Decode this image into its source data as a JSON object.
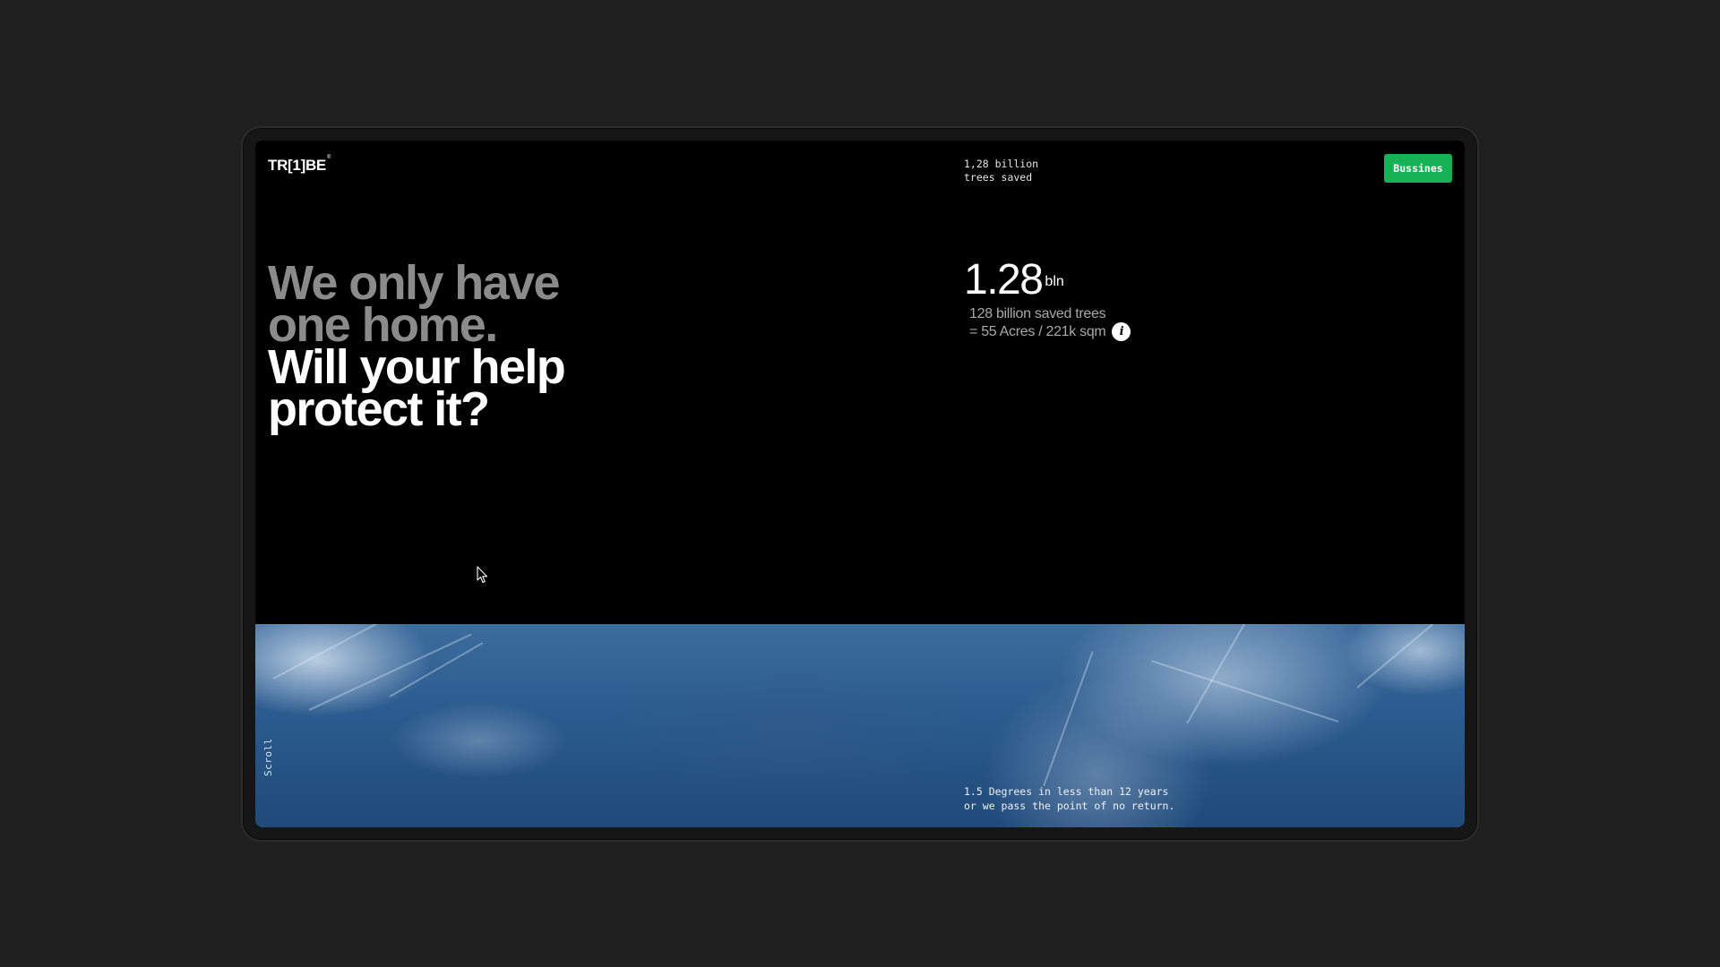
{
  "header": {
    "logo": "TR[1]BE",
    "logo_mark": "®",
    "counter_text": "1,28 billion\ntrees saved",
    "business_button": "Bussines"
  },
  "hero": {
    "line1": "We only have",
    "line2": "one home.",
    "line3": "Will your help",
    "line4": "protect it?"
  },
  "stat": {
    "value": "1.28",
    "unit": "bln",
    "desc_line1": "128 billion saved trees",
    "desc_line2": "= 55 Acres / 221k sqm",
    "info_icon": "info-icon"
  },
  "footer": {
    "scroll_label": "Scroll",
    "caption": "1.5 Degrees in less than 12 years\nor we pass the point of no return."
  },
  "colors": {
    "background": "#1f1f1f",
    "screen": "#000000",
    "accent": "#17b256",
    "muted_text": "#8b8b8b"
  }
}
